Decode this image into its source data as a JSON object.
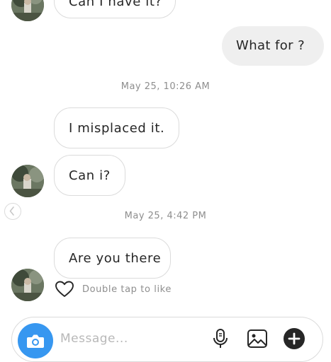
{
  "conversation": {
    "messages": [
      {
        "sender": "them",
        "text": "Can I have it?"
      },
      {
        "sender": "me",
        "text": "What for ?"
      },
      {
        "sender": "them",
        "text": "I misplaced it."
      },
      {
        "sender": "them",
        "text": "Can i?"
      },
      {
        "sender": "them",
        "text": "Are you there"
      }
    ],
    "timestamps": [
      "May 25, 10:26 AM",
      "May 25, 4:42 PM"
    ],
    "like_hint": "Double tap to like"
  },
  "composer": {
    "placeholder": "Message..."
  },
  "icons": {
    "camera": "camera-icon",
    "microphone": "microphone-icon",
    "gallery": "gallery-icon",
    "add": "plus-circle-icon",
    "heart": "heart-outline-icon",
    "back": "chevron-left-icon"
  },
  "colors": {
    "accent": "#3797f0",
    "outgoing_bubble": "#efefef",
    "incoming_border": "#dbdbdb",
    "meta_text": "#8e8e8e"
  }
}
